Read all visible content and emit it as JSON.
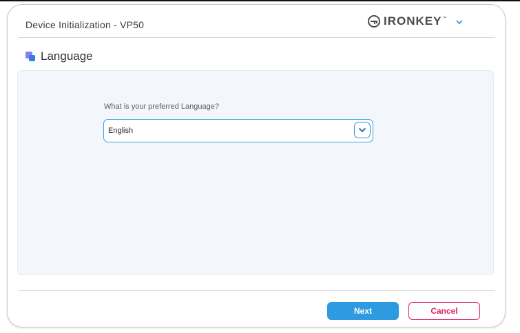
{
  "window": {
    "title": "Device Initialization - VP50"
  },
  "brand": {
    "name": "IRONKEY",
    "trademark": "™",
    "logo_icon": "ironkey-logo-icon",
    "menu_icon": "chevron-down-icon"
  },
  "section": {
    "icon": "language-icon",
    "title": "Language"
  },
  "form": {
    "question": "What is your preferred Language?",
    "language_select": {
      "selected": "English",
      "icon": "chevron-down-icon"
    }
  },
  "footer": {
    "next_label": "Next",
    "cancel_label": "Cancel"
  },
  "colors": {
    "accent": "#2e9ae0",
    "cancel": "#e0245e",
    "panel_bg": "#f3f6fa"
  }
}
